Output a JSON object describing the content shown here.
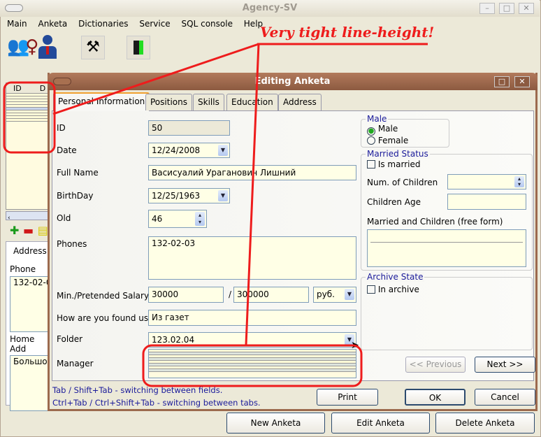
{
  "window": {
    "title": "Agency-SV"
  },
  "menu": [
    "Main",
    "Anketa",
    "Dictionaries",
    "Service",
    "SQL console",
    "Help"
  ],
  "toolbar": [
    "people-icon",
    "manager-icon",
    "tools-icon",
    "exit-door-icon"
  ],
  "left_table": {
    "headers": [
      "ID",
      "D"
    ]
  },
  "left_panel": {
    "tab": "Address",
    "phone_label": "Phone",
    "phone_value": "132-02-0",
    "home_label": "Home Add",
    "home_value": "Большой"
  },
  "bottom_buttons": {
    "new": "New Anketa",
    "edit": "Edit Anketa",
    "delete": "Delete Anketa"
  },
  "dialog": {
    "title": "Editing Anketa",
    "tabs": [
      "Personal Information",
      "Positions",
      "Skills",
      "Education",
      "Address"
    ],
    "fields": {
      "id_label": "ID",
      "id_value": "50",
      "date_label": "Date",
      "date_value": "12/24/2008",
      "fullname_label": "Full Name",
      "fullname_value": "Васисуалий Ураганович Лишний",
      "birthday_label": "BirthDay",
      "birthday_value": "12/25/1963",
      "old_label": "Old",
      "old_value": "46",
      "phones_label": "Phones",
      "phones_value": "132-02-03",
      "salary_label": "Min./Pretended Salary",
      "salary_min": "30000",
      "salary_sep": "/",
      "salary_max": "300000",
      "currency": "руб.",
      "found_label": "How are you found us",
      "found_value": "Из газет",
      "folder_label": "Folder",
      "folder_value": "123.02.04",
      "manager_label": "Manager"
    },
    "male_group": {
      "title": "Male",
      "options": [
        "Male",
        "Female"
      ],
      "selected": "Male"
    },
    "married_group": {
      "title": "Married Status",
      "is_married": "Is married",
      "is_married_checked": false,
      "children_num": "Num. of Children",
      "children_age": "Children Age",
      "free_form": "Married and Children (free form)"
    },
    "archive_group": {
      "title": "Archive State",
      "in_archive": "In archive",
      "in_archive_checked": false
    },
    "nav": {
      "prev": "<< Previous",
      "next": "Next >>"
    },
    "hints": [
      "Tab / Shift+Tab - switching between fields.",
      "Ctrl+Tab / Ctrl+Shift+Tab - switching between tabs."
    ],
    "buttons": {
      "print": "Print",
      "ok": "OK",
      "cancel": "Cancel"
    }
  },
  "annotation": {
    "text": "Very tight line-height!",
    "color": "#ee1c1c"
  }
}
